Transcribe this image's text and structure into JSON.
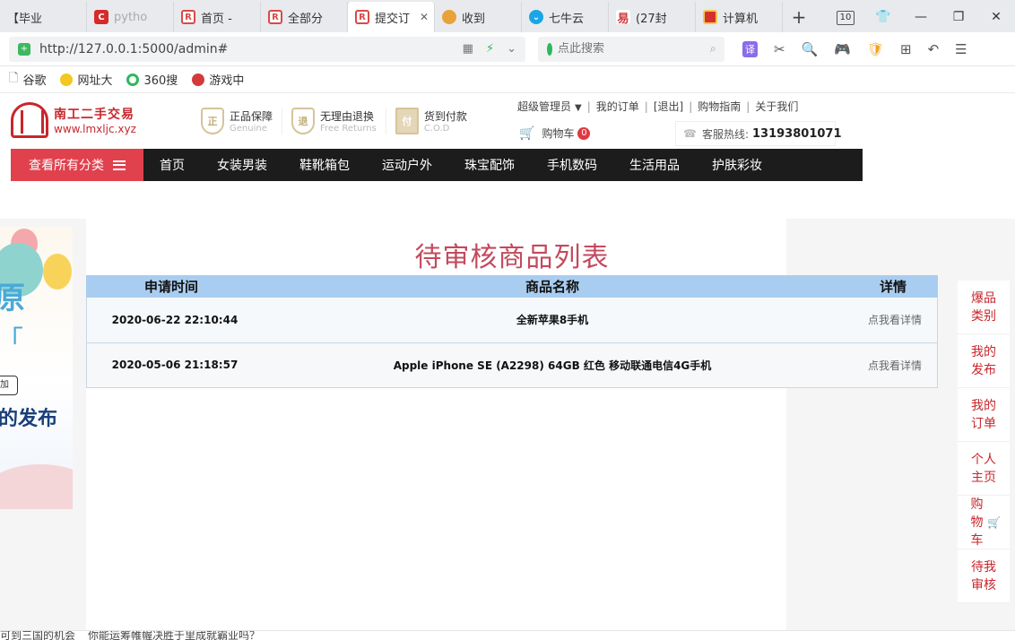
{
  "browser": {
    "tabs": [
      {
        "label": "【毕业",
        "color": "#ffffff",
        "active": false
      },
      {
        "label": "pytho",
        "color": "#d52b2b",
        "active": false
      },
      {
        "label": "首页 -",
        "color": "#d94a4a",
        "active": false
      },
      {
        "label": "全部分",
        "color": "#d94a4a",
        "active": false
      },
      {
        "label": "提交订",
        "color": "#d94a4a",
        "active": true
      },
      {
        "label": "收到",
        "color": "#e8a23a",
        "active": false
      },
      {
        "label": "七牛云",
        "color": "#1aa5e6",
        "active": false
      },
      {
        "label": "(27封",
        "color": "#d23838",
        "active": false
      },
      {
        "label": "计算机",
        "color": "#d72f2f",
        "active": false
      }
    ],
    "tab_count": "10",
    "url": "http://127.0.0.1:5000/admin#",
    "search_placeholder": "点此搜索",
    "translate_label": "译"
  },
  "bookmarks": [
    {
      "label": "谷歌",
      "color": "#ffffff"
    },
    {
      "label": "网址大",
      "color": "#f2c81e"
    },
    {
      "label": "360搜",
      "color": "#2eb85c"
    },
    {
      "label": "游戏中",
      "color": "#d43a3a"
    }
  ],
  "site": {
    "logo_cn": "南工二手交易",
    "logo_en": "www.lmxljc.xyz",
    "guarantees": [
      {
        "title": "正品保障",
        "sub": "Genuine",
        "glyph": "正"
      },
      {
        "title": "无理由退换",
        "sub": "Free Returns",
        "glyph": "退"
      },
      {
        "title": "货到付款",
        "sub": "C.O.D",
        "glyph": "付"
      }
    ],
    "user_menu": "超级管理员",
    "links": [
      "我的订单",
      "[退出]",
      "购物指南",
      "关于我们"
    ],
    "cart_label": "购物车",
    "cart_count": "0",
    "hotline_label": "客服热线:",
    "hotline_number": "13193801071",
    "nav_all": "查看所有分类",
    "nav_items": [
      "首页",
      "女装男装",
      "鞋靴箱包",
      "运动户外",
      "珠宝配饰",
      "手机数码",
      "生活用品",
      "护肤彩妆"
    ]
  },
  "ad": {
    "big_text": "原",
    "big_text2": "「",
    "tag": "加",
    "fabu": "的发布"
  },
  "main": {
    "title": "待审核商品列表",
    "columns": [
      "申请时间",
      "商品名称",
      "详情"
    ],
    "rows": [
      {
        "time": "2020-06-22 22:10:44",
        "name": "全新苹果8手机",
        "detail": "点我看详情"
      },
      {
        "time": "2020-05-06 21:18:57",
        "name": "Apple iPhone SE (A2298) 64GB 红色 移动联通电信4G手机",
        "detail": "点我看详情"
      }
    ]
  },
  "side_menu": [
    "爆品类别",
    "我的发布",
    "我的订单",
    "个人主页",
    "购物车",
    "待我审核"
  ],
  "statusbar": [
    "可到三国的机会",
    "你能运筹帷幄决胜于里成就霸业吗？"
  ],
  "colors": {
    "brand_red": "#c8262c",
    "nav_dark": "#1c1c1c",
    "nav_accent": "#e0414d",
    "table_header": "#a9cdf0",
    "title_pink": "#c34a5e"
  }
}
